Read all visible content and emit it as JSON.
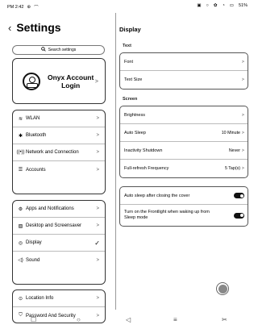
{
  "status_bar": {
    "time": "PM 2:42",
    "battery": "51%",
    "icons": [
      "bluetooth-icon",
      "sync-icon",
      "screenshot-icon",
      "settings-icon",
      "battery-icon",
      "wifi-icon"
    ]
  },
  "header": {
    "back_label": "‹",
    "title": "Settings"
  },
  "search": {
    "placeholder": "Search settings"
  },
  "account": {
    "line1": "Onyx Account",
    "line2": "Login"
  },
  "menu_groups": [
    [
      {
        "label": "WLAN",
        "icon": "wifi-icon"
      },
      {
        "label": "Bluetooth",
        "icon": "bluetooth-icon"
      },
      {
        "label": "Network and Connection",
        "icon": "network-icon"
      },
      {
        "label": "Accounts",
        "icon": "accounts-icon"
      }
    ],
    [
      {
        "label": "Apps and Notifications",
        "icon": "apps-icon"
      },
      {
        "label": "Desktop and Screensaver",
        "icon": "desktop-icon"
      },
      {
        "label": "Display",
        "icon": "display-icon",
        "selected": true
      },
      {
        "label": "Sound",
        "icon": "sound-icon"
      }
    ],
    [
      {
        "label": "Location Info",
        "icon": "location-icon"
      },
      {
        "label": "Password And Security",
        "icon": "shield-icon"
      }
    ]
  ],
  "display": {
    "title": "Display",
    "text_section": "Text",
    "text_rows": [
      {
        "label": "Font",
        "value": ""
      },
      {
        "label": "Text Size",
        "value": ""
      }
    ],
    "screen_section": "Screen",
    "screen_rows": [
      {
        "label": "Brightness",
        "value": ""
      },
      {
        "label": "Auto Sleep",
        "value": "10 Minute"
      },
      {
        "label": "Inactivity Shutdown",
        "value": "Never"
      },
      {
        "label": "Full-refresh Frequency",
        "value": "5 Tap(s)"
      }
    ],
    "toggles": [
      {
        "label": "Auto sleep after closing the cover",
        "on": true
      },
      {
        "label": "Turn on the Frontlight when waking up from Sleep mode",
        "on": true
      }
    ]
  }
}
